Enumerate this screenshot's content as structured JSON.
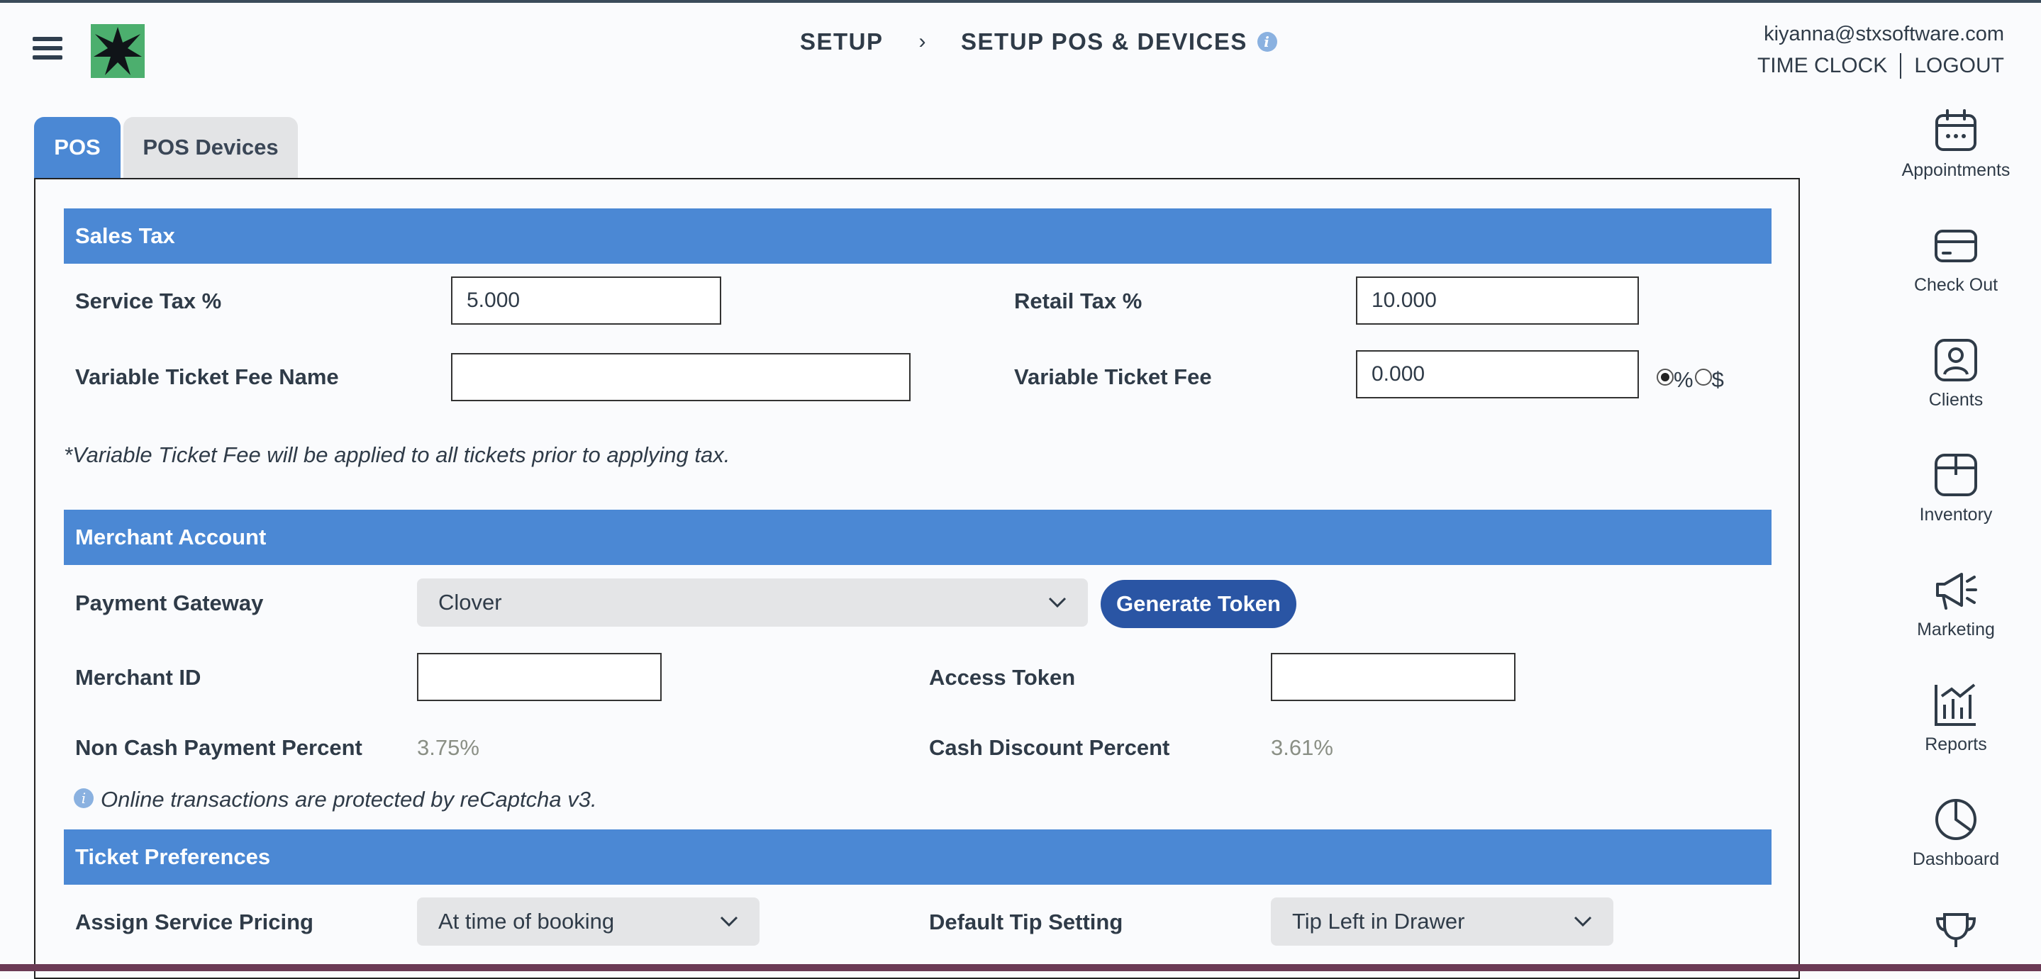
{
  "header": {
    "crumb_1": "SETUP",
    "crumb_sep": "›",
    "crumb_2": "SETUP POS & DEVICES",
    "info_glyph": "i",
    "email": "kiyanna@stxsoftware.com",
    "time_clock": "TIME CLOCK",
    "logout": "LOGOUT"
  },
  "tabs": [
    {
      "label": "POS",
      "active": true
    },
    {
      "label": "POS Devices",
      "active": false
    }
  ],
  "sales_tax": {
    "title": "Sales Tax",
    "service_tax_label": "Service Tax %",
    "service_tax_value": "5.000",
    "retail_tax_label": "Retail Tax %",
    "retail_tax_value": "10.000",
    "fee_name_label": "Variable Ticket Fee Name",
    "fee_name_value": "",
    "fee_label": "Variable Ticket Fee",
    "fee_value": "0.000",
    "fee_unit_percent": "%",
    "fee_unit_dollar": "$",
    "fee_unit_selected": "%",
    "note": "*Variable Ticket Fee will be applied to all tickets prior to applying tax."
  },
  "merchant": {
    "title": "Merchant Account",
    "gateway_label": "Payment Gateway",
    "gateway_value": "Clover",
    "generate_token": "Generate Token",
    "merchant_id_label": "Merchant ID",
    "merchant_id_value": "",
    "access_token_label": "Access Token",
    "access_token_value": "",
    "non_cash_label": "Non Cash Payment Percent",
    "non_cash_value": "3.75%",
    "cash_discount_label": "Cash Discount Percent",
    "cash_discount_value": "3.61%",
    "recaptcha_note": "Online transactions are protected by reCaptcha v3."
  },
  "ticket": {
    "title": "Ticket Preferences",
    "pricing_label": "Assign Service Pricing",
    "pricing_value": "At time of booking",
    "tip_label": "Default Tip Setting",
    "tip_value": "Tip Left in Drawer"
  },
  "sidebar": {
    "items": [
      {
        "label": "Appointments",
        "icon": "calendar-icon"
      },
      {
        "label": "Check Out",
        "icon": "credit-card-icon"
      },
      {
        "label": "Clients",
        "icon": "client-icon"
      },
      {
        "label": "Inventory",
        "icon": "box-icon"
      },
      {
        "label": "Marketing",
        "icon": "megaphone-icon"
      },
      {
        "label": "Reports",
        "icon": "chart-icon"
      },
      {
        "label": "Dashboard",
        "icon": "pie-icon"
      },
      {
        "label": "",
        "icon": "trophy-icon"
      }
    ]
  },
  "colors": {
    "accent": "#4b88d4",
    "button": "#2a55a4",
    "logo_green": "#4caf6e",
    "muted_value": "#8a8f85"
  }
}
